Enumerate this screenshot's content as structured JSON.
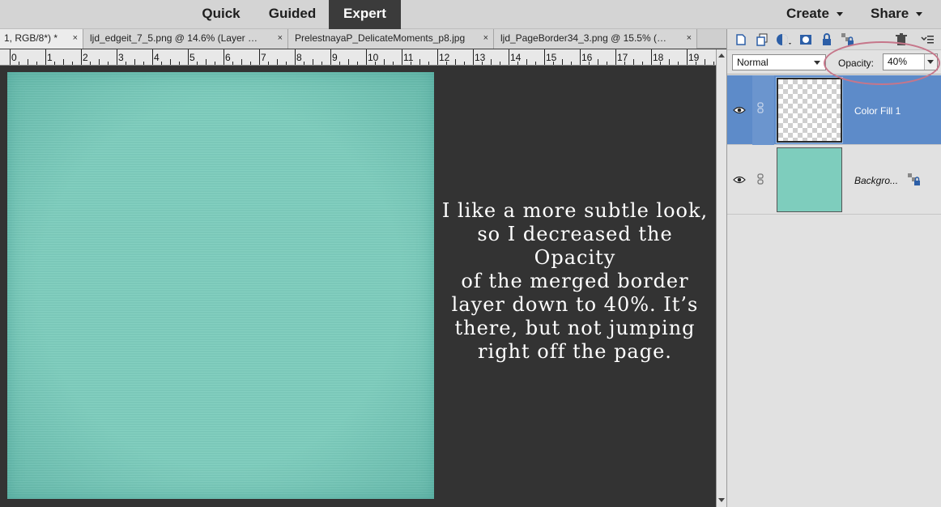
{
  "topbar": {
    "modes": [
      "Quick",
      "Guided",
      "Expert"
    ],
    "active_mode": "Expert",
    "create_label": "Create",
    "share_label": "Share"
  },
  "tabs": [
    {
      "label": "1, RGB/8*) *",
      "close": "×",
      "active": true
    },
    {
      "label": "ljd_edgeit_7_5.png @ 14.6% (Layer …",
      "close": "×",
      "active": false
    },
    {
      "label": "PrelestnayaP_DelicateMoments_p8.jpg",
      "close": "×",
      "active": false
    },
    {
      "label": "ljd_PageBorder34_3.png @ 15.5% (…",
      "close": "×",
      "active": false
    }
  ],
  "ruler": {
    "numbers": [
      "0",
      "1",
      "2",
      "3",
      "4",
      "5",
      "6",
      "7",
      "8",
      "9",
      "10",
      "11",
      "12",
      "13",
      "14",
      "15",
      "16",
      "17",
      "18",
      "19"
    ]
  },
  "canvas": {
    "paper_color": "#7ecdbd",
    "note_lines": [
      "I like a more subtle look,",
      "so I decreased the Opacity",
      "of the merged border",
      "layer down to 40%. It’s",
      "there, but not jumping",
      "right off the page."
    ]
  },
  "layers_panel": {
    "blend_mode": "Normal",
    "opacity_label": "Opacity:",
    "opacity_value": "40%",
    "highlight_color": "#c6768a",
    "layers": [
      {
        "name": "Color Fill 1",
        "selected": true,
        "thumb": "transparent-checker"
      },
      {
        "name": "Backgro...",
        "selected": false,
        "thumb": "teal-fill",
        "locked": true
      }
    ],
    "toolbar_icons": [
      "new-layer-icon",
      "duplicate-layer-icon",
      "adjustment-layer-icon",
      "layer-mask-icon",
      "lock-all-icon",
      "lock-transparency-icon",
      "delete-layer-icon",
      "panel-menu-icon"
    ]
  }
}
